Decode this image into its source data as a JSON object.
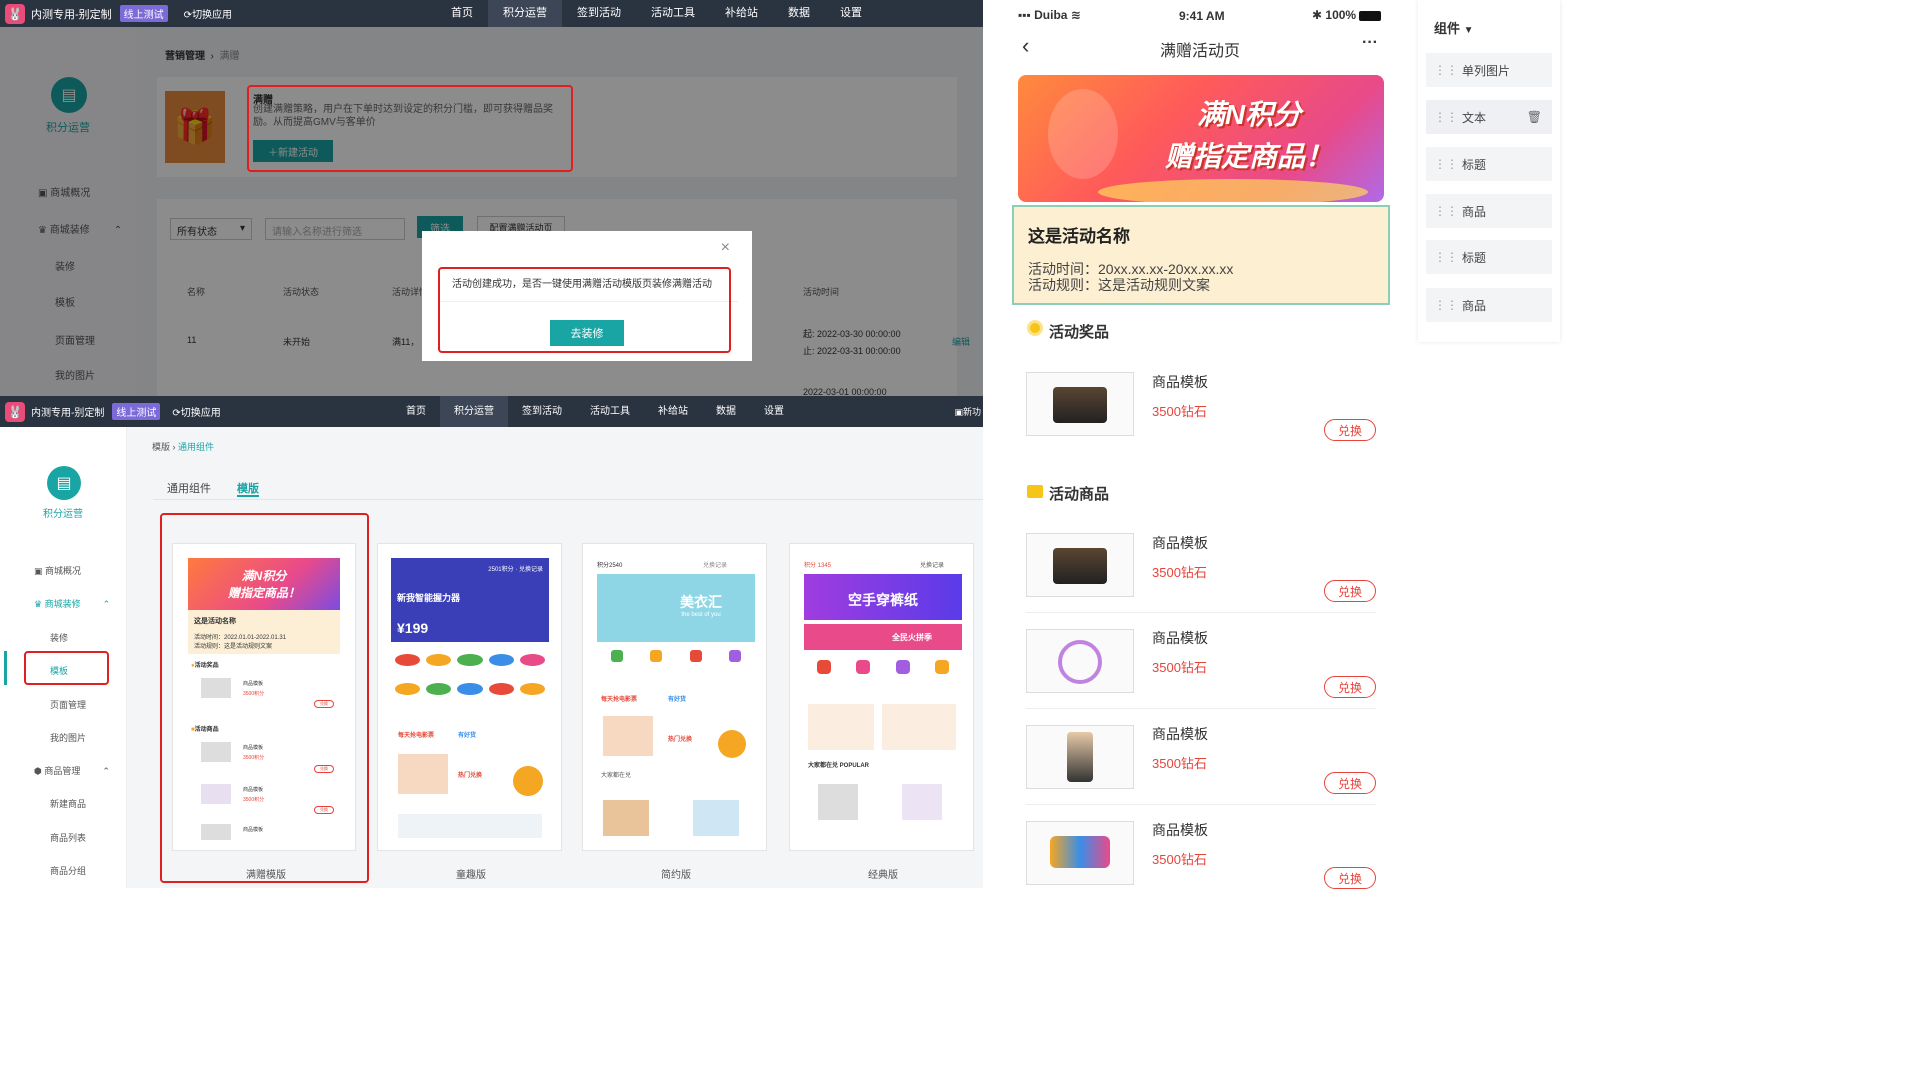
{
  "top": {
    "app_name": "内测专用-别定制",
    "badge": "线上测试",
    "switch": "切换应用",
    "nav": [
      "首页",
      "积分运营",
      "签到活动",
      "活动工具",
      "补给站",
      "数据",
      "设置"
    ],
    "right_extra": "新功"
  },
  "sidebar_top": {
    "section": "积分运营",
    "items": [
      "商城概况",
      "商城装修",
      "装修",
      "模板",
      "页面管理",
      "我的图片"
    ]
  },
  "main_top": {
    "breadcrumb": [
      "营销管理",
      "满赠"
    ],
    "feature_title": "满赠",
    "feature_desc": "创建满赠策略，用户在下单时达到设定的积分门槛，即可获得赠品奖励。从而提高GMV与客单价",
    "new_btn": "新建活动",
    "filter_status": "所有状态",
    "search_placeholder": "请输入名称进行筛选",
    "filter_btn": "筛选",
    "config_btn": "配置满赠活动页",
    "columns": [
      "名称",
      "活动状态",
      "活动详情",
      "活动时间"
    ],
    "row": {
      "name": "11",
      "status": "未开始",
      "detail": "满11，",
      "start": "起: 2022-03-30 00:00:00",
      "end": "止: 2022-03-31 00:00:00",
      "edit": "编辑"
    },
    "next_row_time": "2022-03-01 00:00:00"
  },
  "dialog": {
    "message": "活动创建成功，是否一键使用满赠活动模版页装修满赠活动",
    "button": "去装修",
    "close": "×"
  },
  "sidebar_bottom": {
    "section": "积分运营",
    "items": [
      "商城概况",
      "商城装修",
      "装修",
      "模板",
      "页面管理",
      "我的图片",
      "商品管理",
      "新建商品",
      "商品列表",
      "商品分组"
    ]
  },
  "main_bottom": {
    "breadcrumb": [
      "模版",
      "通用组件"
    ],
    "tabs": [
      "通用组件",
      "模版"
    ],
    "templates": [
      "满赠模版",
      "童趣版",
      "简约版",
      "经典版"
    ],
    "t1": {
      "banner1": "满N积分",
      "banner2": "赠指定商品！",
      "name": "这是活动名称",
      "time": "活动时间：2022.01.01-2022.01.31",
      "rule": "活动规则：这是活动规则文案",
      "prize": "活动奖品",
      "goods": "活动商品",
      "prod": "商品模板",
      "price": "3500积分",
      "exch": "兑换"
    },
    "t2": {
      "points": "2501积分",
      "record": "兑换记录",
      "title": "新我智能握力器",
      "price": "¥199",
      "promo1": "每天抢电影票",
      "promo2": "有好货",
      "promo3": "热门兑换"
    },
    "t3": {
      "points": "积分2540",
      "record": "兑换记录",
      "banner": "美衣汇",
      "sub": "the best of you",
      "promo1": "每天抢电影票",
      "promo2": "有好货",
      "promo3": "热门兑换",
      "more": "大家都在兑"
    },
    "t4": {
      "points": "积分 1345",
      "record": "兑换记录",
      "banner": "空手穿裤纸",
      "promo": "全民火拼季",
      "popular": "大家都在兑 POPULAR"
    }
  },
  "phone": {
    "carrier": "Duiba",
    "time": "9:41 AM",
    "battery": "100%",
    "title": "满赠活动页",
    "more": "···",
    "banner_line1": "满N积分",
    "banner_line2": "赠指定商品！",
    "activity_name": "这是活动名称",
    "activity_time": "活动时间：20xx.xx.xx-20xx.xx.xx",
    "activity_rule": "活动规则：这是活动规则文案",
    "prize_title": "活动奖品",
    "goods_title": "活动商品",
    "products": [
      {
        "name": "商品模板",
        "price": "3500钻石",
        "btn": "兑换"
      },
      {
        "name": "商品模板",
        "price": "3500钻石",
        "btn": "兑换"
      },
      {
        "name": "商品模板",
        "price": "3500钻石",
        "btn": "兑换"
      },
      {
        "name": "商品模板",
        "price": "3500钻石",
        "btn": "兑换"
      },
      {
        "name": "商品模板",
        "price": "3500钻石",
        "btn": "兑换"
      }
    ]
  },
  "components": {
    "header": "组件",
    "items": [
      "单列图片",
      "文本",
      "标题",
      "商品",
      "标题",
      "商品"
    ]
  }
}
